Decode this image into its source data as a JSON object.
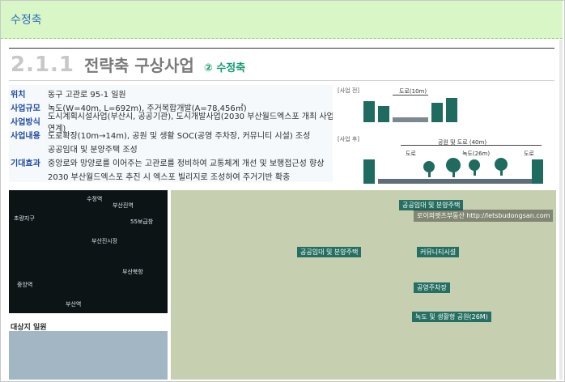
{
  "panel": {
    "title": "수정축"
  },
  "section": {
    "number": "2.1.1",
    "title": "전략축 구상사업",
    "subtitle": "② 수정축"
  },
  "project_info": [
    {
      "label": "위치",
      "value": "동구 고관로 95-1 일원"
    },
    {
      "label": "사업규모",
      "value": "녹도(W=40m, L=692m), 주거복합개발(A=78,456㎡)"
    },
    {
      "label": "사업방식",
      "value": "도시계획시설사업(부산시, 공공기관), 도시개발사업(2030 부산월드엑스포 개최 사업 연계)"
    },
    {
      "label": "사업내용",
      "value": "도로확장(10m→14m), 공원 및 생활 SOC(공영 주차장, 커뮤니티 시설) 조성"
    },
    {
      "label": "",
      "value": "공공임대 및 분양주택 조성"
    },
    {
      "label": "기대효과",
      "value": "중앙로와 망양로를 이어주는 고관로를 정비하여 교통체계 개선 및 보행접근성 향상"
    },
    {
      "label": "",
      "value": "2030 부산월드엑스포 추진 시 엑스포 빌리지로 조성하여 주거기반 확충"
    }
  ],
  "diagram": {
    "before_tag": "[사업 전]",
    "after_tag": "[사업 후]",
    "road_before": "도로(10m)",
    "park_road": "공원 및 도로 (40m)",
    "road_left": "도로",
    "green_road": "녹도(26m)",
    "road_right": "도로"
  },
  "photos": {
    "left_map_labels": [
      "수정역",
      "부산진역",
      "55보급창",
      "부산진시장",
      "초량지구",
      "부산북항",
      "중앙역",
      "부산역"
    ],
    "left_bottom_label": "대상지 일원",
    "right_captions": [
      "공공임대 및 분양주택",
      "공공임대 및 분양주택",
      "커뮤니티시설",
      "공영주차장",
      "녹도 및 생활형 공원(26M)"
    ],
    "watermark": "로이의렛츠부동산 http://letsbudongsan.com"
  }
}
